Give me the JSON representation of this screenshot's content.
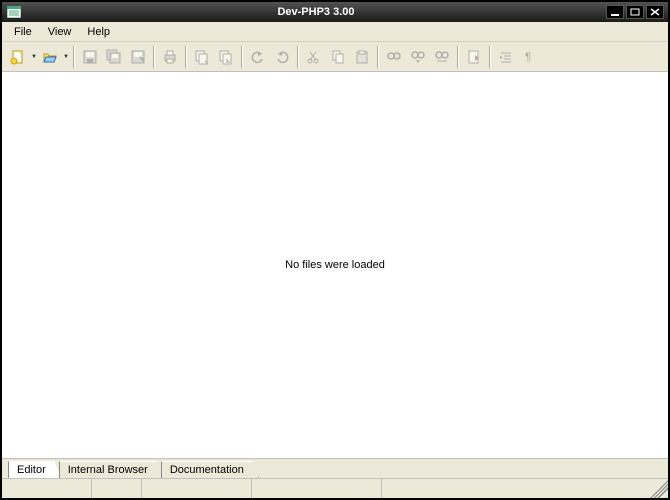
{
  "window": {
    "title": "Dev-PHP3 3.00"
  },
  "menu": {
    "items": [
      "File",
      "View",
      "Help"
    ]
  },
  "toolbar": {
    "groups": [
      {
        "items": [
          {
            "name": "new-file-icon",
            "enabled": true,
            "dropdown": true
          },
          {
            "name": "open-file-icon",
            "enabled": true,
            "dropdown": true
          }
        ]
      },
      {
        "items": [
          {
            "name": "save-icon",
            "enabled": false
          },
          {
            "name": "save-all-icon",
            "enabled": false
          },
          {
            "name": "save-as-icon",
            "enabled": false
          }
        ]
      },
      {
        "items": [
          {
            "name": "print-icon",
            "enabled": false
          }
        ]
      },
      {
        "items": [
          {
            "name": "copy-doc-icon",
            "enabled": false
          },
          {
            "name": "paste-doc-icon",
            "enabled": false
          }
        ]
      },
      {
        "items": [
          {
            "name": "undo-icon",
            "enabled": false
          },
          {
            "name": "redo-icon",
            "enabled": false
          }
        ]
      },
      {
        "items": [
          {
            "name": "cut-icon",
            "enabled": false
          },
          {
            "name": "copy-icon",
            "enabled": false
          },
          {
            "name": "paste-icon",
            "enabled": false
          }
        ]
      },
      {
        "items": [
          {
            "name": "find-icon",
            "enabled": false
          },
          {
            "name": "find-next-icon",
            "enabled": false
          },
          {
            "name": "replace-icon",
            "enabled": false
          }
        ]
      },
      {
        "items": [
          {
            "name": "goto-icon",
            "enabled": false
          }
        ]
      },
      {
        "items": [
          {
            "name": "indent-icon",
            "enabled": false
          },
          {
            "name": "show-special-icon",
            "enabled": false
          }
        ]
      }
    ]
  },
  "content": {
    "empty_message": "No files were loaded"
  },
  "tabs": {
    "items": [
      "Editor",
      "Internal Browser",
      "Documentation"
    ],
    "active_index": 0
  },
  "statusbar": {
    "cells_widths": [
      90,
      50,
      110,
      130
    ]
  }
}
